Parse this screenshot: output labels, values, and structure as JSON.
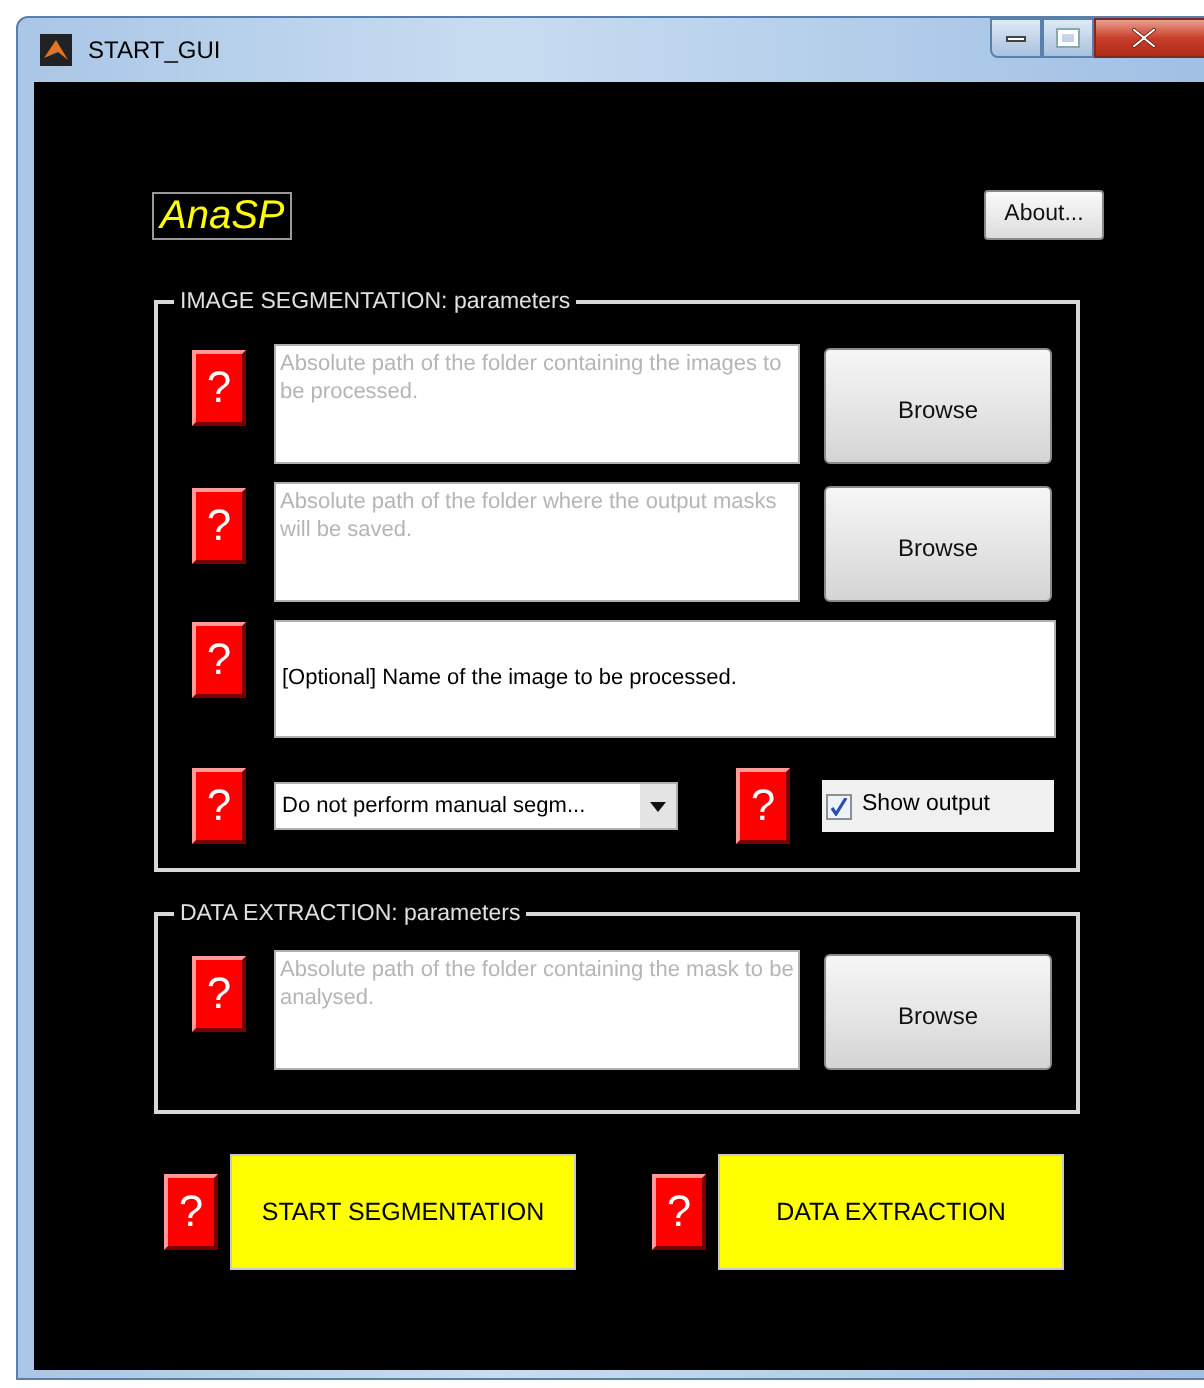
{
  "window": {
    "title": "START_GUI"
  },
  "logo": "AnaSP",
  "about_button": "About...",
  "image_segmentation": {
    "title": "IMAGE SEGMENTATION: parameters",
    "path_fields": [
      {
        "help": "?",
        "placeholder": "Absolute path of the folder containing the images to be processed.",
        "browse": "Browse"
      },
      {
        "help": "?",
        "placeholder": "Absolute path of the folder where the output masks will be saved.",
        "browse": "Browse"
      }
    ],
    "name_field": {
      "help": "?",
      "value": "[Optional] Name of the image to be processed."
    },
    "dropdown": {
      "help": "?",
      "value": "Do not perform manual segm..."
    },
    "show_output": {
      "help": "?",
      "label": "Show output",
      "checked": true
    }
  },
  "data_extraction": {
    "title": "DATA EXTRACTION: parameters",
    "path_fields": [
      {
        "help": "?",
        "placeholder": "Absolute path of the folder containing the mask to be analysed.",
        "browse": "Browse"
      }
    ]
  },
  "actions": [
    {
      "help": "?",
      "label": "START SEGMENTATION"
    },
    {
      "help": "?",
      "label": "DATA EXTRACTION"
    }
  ]
}
